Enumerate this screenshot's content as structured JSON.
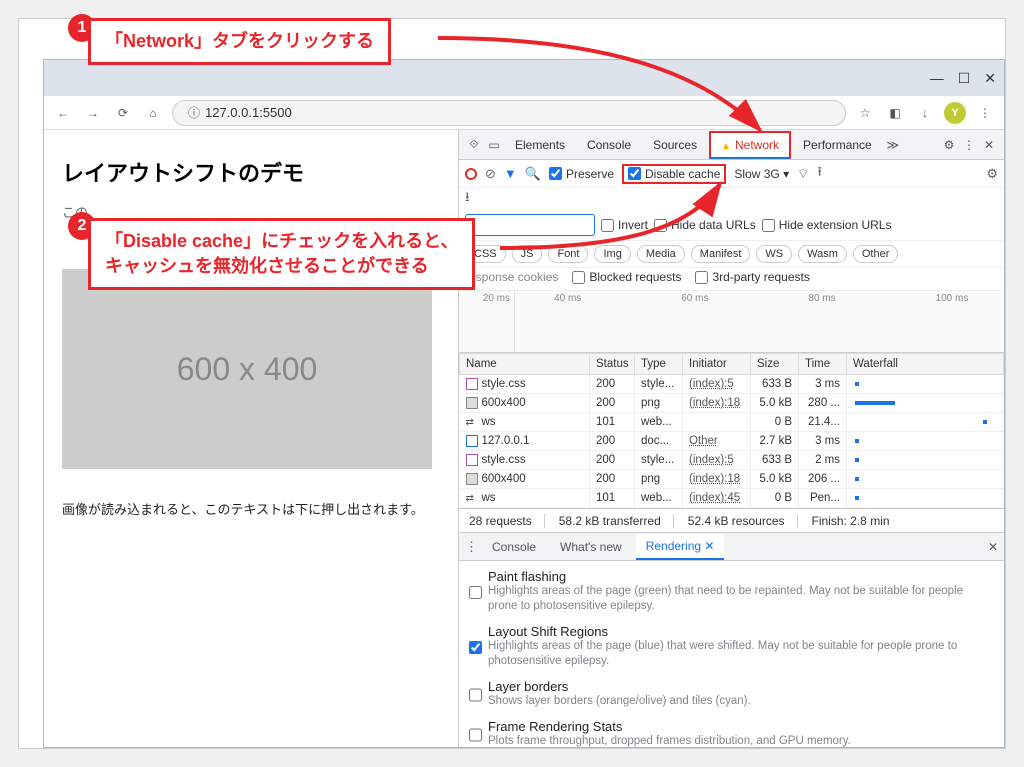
{
  "window_controls": {
    "minimize": "—",
    "maximize": "☐",
    "close": "✕"
  },
  "nav": {
    "back": "←",
    "forward": "→",
    "reload": "⟳",
    "home": "⌂",
    "info": "ⓘ",
    "star": "☆",
    "ext": "◧",
    "download": "↓",
    "menu": "⋮",
    "avatar": "Y"
  },
  "address": "127.0.0.1:5500",
  "page": {
    "title": "レイアウトシフトのデモ",
    "text1": "この",
    "placeholder": "600 x 400",
    "push_text": "画像が読み込まれると、このテキストは下に押し出されます。"
  },
  "devtools_tabs": [
    "Elements",
    "Console",
    "Sources",
    "Network",
    "Performance"
  ],
  "net_toolbar": {
    "preserve": "Preserve",
    "disable_cache": "Disable cache",
    "throttling": "Slow 3G"
  },
  "net_filters": {
    "invert": "Invert",
    "hide_data": "Hide data URLs",
    "hide_ext": "Hide extension URLs",
    "pills": [
      "CSS",
      "JS",
      "Font",
      "Img",
      "Media",
      "Manifest",
      "WS",
      "Wasm",
      "Other"
    ],
    "blocked_cookies": "response cookies",
    "blocked": "Blocked requests",
    "thirdparty": "3rd-party requests"
  },
  "timeline_marks": [
    "20 ms",
    "40 ms",
    "60 ms",
    "80 ms",
    "100 ms"
  ],
  "net_headers": [
    "Name",
    "Status",
    "Type",
    "Initiator",
    "Size",
    "Time",
    "Waterfall"
  ],
  "net_rows": [
    {
      "icon": "css",
      "name": "style.css",
      "status": "200",
      "type": "style...",
      "initiator": "(index):5",
      "size": "633 B",
      "time": "3 ms",
      "wf": 4
    },
    {
      "icon": "img",
      "name": "600x400",
      "status": "200",
      "type": "png",
      "initiator": "(index):18",
      "size": "5.0 kB",
      "time": "280 ...",
      "wf": 40
    },
    {
      "icon": "ws",
      "name": "ws",
      "status": "101",
      "type": "web...",
      "initiator": "",
      "size": "0 B",
      "time": "21.4...",
      "wf": 4
    },
    {
      "icon": "doc",
      "name": "127.0.0.1",
      "status": "200",
      "type": "doc...",
      "initiator": "Other",
      "size": "2.7 kB",
      "time": "3 ms",
      "wf": 4
    },
    {
      "icon": "css",
      "name": "style.css",
      "status": "200",
      "type": "style...",
      "initiator": "(index):5",
      "size": "633 B",
      "time": "2 ms",
      "wf": 4
    },
    {
      "icon": "img",
      "name": "600x400",
      "status": "200",
      "type": "png",
      "initiator": "(index):18",
      "size": "5.0 kB",
      "time": "206 ...",
      "wf": 4
    },
    {
      "icon": "ws",
      "name": "ws",
      "status": "101",
      "type": "web...",
      "initiator": "(index):45",
      "size": "0 B",
      "time": "Pen...",
      "wf": 4
    }
  ],
  "net_summary": {
    "requests": "28 requests",
    "transferred": "58.2 kB transferred",
    "resources": "52.4 kB resources",
    "finish": "Finish: 2.8 min"
  },
  "drawer_tabs": [
    "Console",
    "What's new",
    "Rendering"
  ],
  "rendering": [
    {
      "checked": false,
      "title": "Paint flashing",
      "desc": "Highlights areas of the page (green) that need to be repainted. May not be suitable for people prone to photosensitive epilepsy."
    },
    {
      "checked": true,
      "title": "Layout Shift Regions",
      "desc": "Highlights areas of the page (blue) that were shifted. May not be suitable for people prone to photosensitive epilepsy."
    },
    {
      "checked": false,
      "title": "Layer borders",
      "desc": "Shows layer borders (orange/olive) and tiles (cyan)."
    },
    {
      "checked": false,
      "title": "Frame Rendering Stats",
      "desc": "Plots frame throughput, dropped frames distribution, and GPU memory."
    }
  ],
  "annotation": {
    "num1": "1",
    "num2": "2",
    "text1": "「Network」タブをクリックする",
    "text2_l1": "「Disable cache」にチェックを入れると、",
    "text2_l2": "キャッシュを無効化させることができる"
  }
}
